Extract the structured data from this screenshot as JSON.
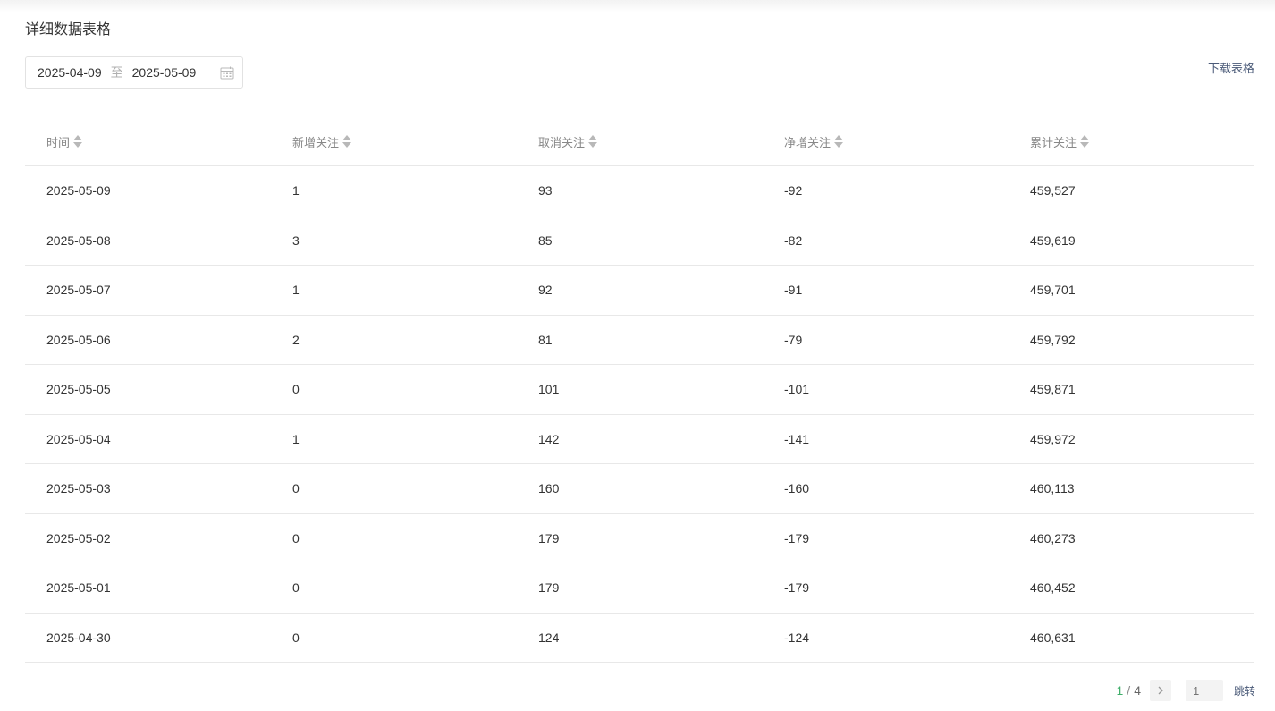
{
  "section_title": "详细数据表格",
  "date_range": {
    "start": "2025-04-09",
    "separator": "至",
    "end": "2025-05-09",
    "icon": "calendar-icon"
  },
  "download_label": "下载表格",
  "table": {
    "columns": [
      "时间",
      "新增关注",
      "取消关注",
      "净增关注",
      "累计关注"
    ],
    "rows": [
      [
        "2025-05-09",
        "1",
        "93",
        "-92",
        "459,527"
      ],
      [
        "2025-05-08",
        "3",
        "85",
        "-82",
        "459,619"
      ],
      [
        "2025-05-07",
        "1",
        "92",
        "-91",
        "459,701"
      ],
      [
        "2025-05-06",
        "2",
        "81",
        "-79",
        "459,792"
      ],
      [
        "2025-05-05",
        "0",
        "101",
        "-101",
        "459,871"
      ],
      [
        "2025-05-04",
        "1",
        "142",
        "-141",
        "459,972"
      ],
      [
        "2025-05-03",
        "0",
        "160",
        "-160",
        "460,113"
      ],
      [
        "2025-05-02",
        "0",
        "179",
        "-179",
        "460,273"
      ],
      [
        "2025-05-01",
        "0",
        "179",
        "-179",
        "460,452"
      ],
      [
        "2025-04-30",
        "0",
        "124",
        "-124",
        "460,631"
      ]
    ]
  },
  "pagination": {
    "current": "1",
    "slash": "/",
    "total": "4",
    "input_placeholder": "1",
    "jump_label": "跳转"
  },
  "colors": {
    "accent_green": "#3fae6a",
    "link": "#4a5a78",
    "border": "#e8e8e8"
  }
}
